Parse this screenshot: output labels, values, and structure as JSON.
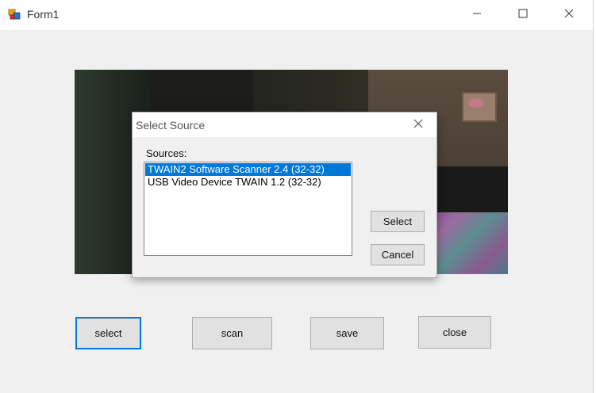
{
  "window": {
    "title": "Form1"
  },
  "dialog": {
    "title": "Select Source",
    "sources_label": "Sources:",
    "sources": [
      {
        "label": "TWAIN2 Software Scanner 2.4 (32-32)",
        "selected": true
      },
      {
        "label": "USB Video Device TWAIN 1.2 (32-32)",
        "selected": false
      }
    ],
    "select_label": "Select",
    "cancel_label": "Cancel"
  },
  "buttons": {
    "select": "select",
    "scan": "scan",
    "save": "save",
    "close": "close"
  },
  "icons": {
    "app": "app-icon",
    "minimize": "minimize-icon",
    "maximize": "maximize-icon",
    "close": "close-icon"
  },
  "colors": {
    "selection": "#0078d7",
    "focus_border": "#0078d7",
    "button_bg": "#e1e1e1"
  }
}
